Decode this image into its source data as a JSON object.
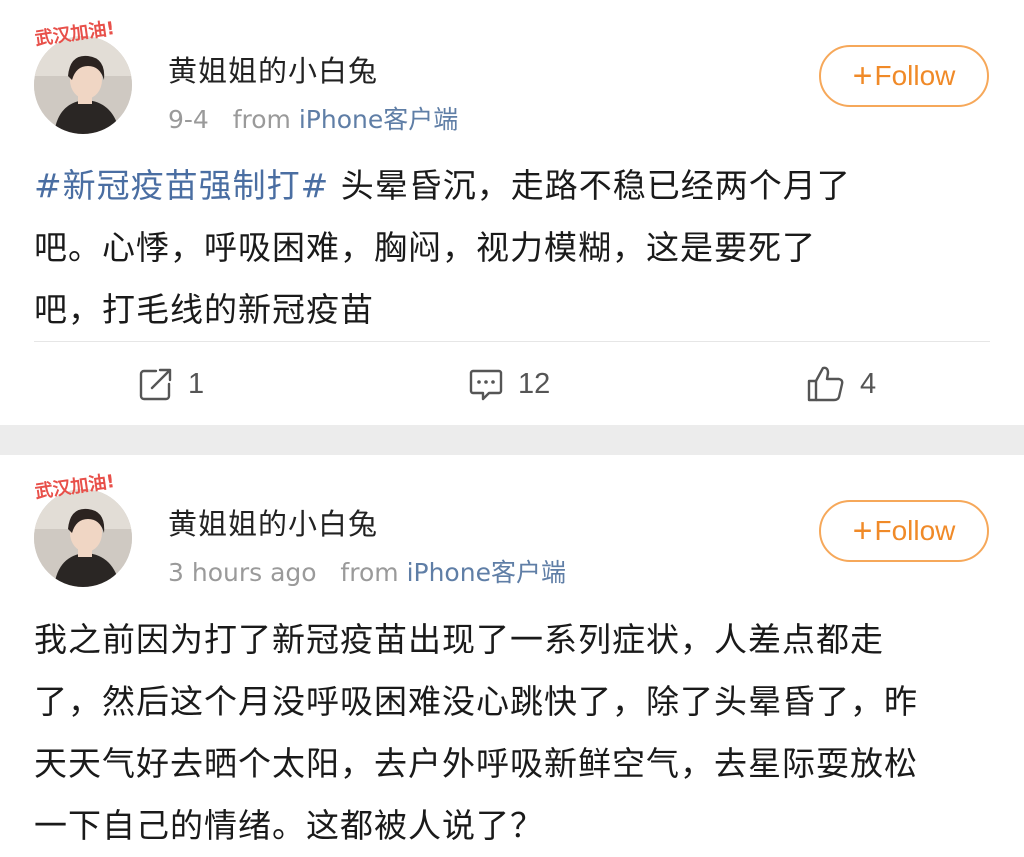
{
  "posts": [
    {
      "author": "黄姐姐的小白兔",
      "avatar_stamp": "武汉加油!",
      "time": "9-4",
      "from_label": "from",
      "source": "iPhone客户端",
      "follow_plus": "+",
      "follow_label": "Follow",
      "hashtag": "#新冠疫苗强制打#",
      "text_line1": " 头晕昏沉，走路不稳已经两个月了",
      "text_line2": "吧。心悸，呼吸困难，胸闷，视力模糊，这是要死了",
      "text_line3": "吧，打毛线的新冠疫苗",
      "actions": {
        "repost_count": "1",
        "comment_count": "12",
        "like_count": "4"
      }
    },
    {
      "author": "黄姐姐的小白兔",
      "avatar_stamp": "武汉加油!",
      "time": "3 hours ago",
      "from_label": "from",
      "source": "iPhone客户端",
      "follow_plus": "+",
      "follow_label": "Follow",
      "text_line1": "我之前因为打了新冠疫苗出现了一系列症状，人差点都走",
      "text_line2": "了，然后这个月没呼吸困难没心跳快了，除了头晕昏了，昨",
      "text_line3": "天天气好去晒个太阳，去户外呼吸新鲜空气，去星际耍放松",
      "text_line4": "一下自己的情绪。这都被人说了？"
    }
  ],
  "colors": {
    "follow_accent": "#f08a28",
    "hashtag": "#4a6ea2",
    "source_link": "#5f7ea6",
    "separator": "#ececec"
  },
  "icons": [
    "repost-icon",
    "comment-icon",
    "like-icon"
  ]
}
